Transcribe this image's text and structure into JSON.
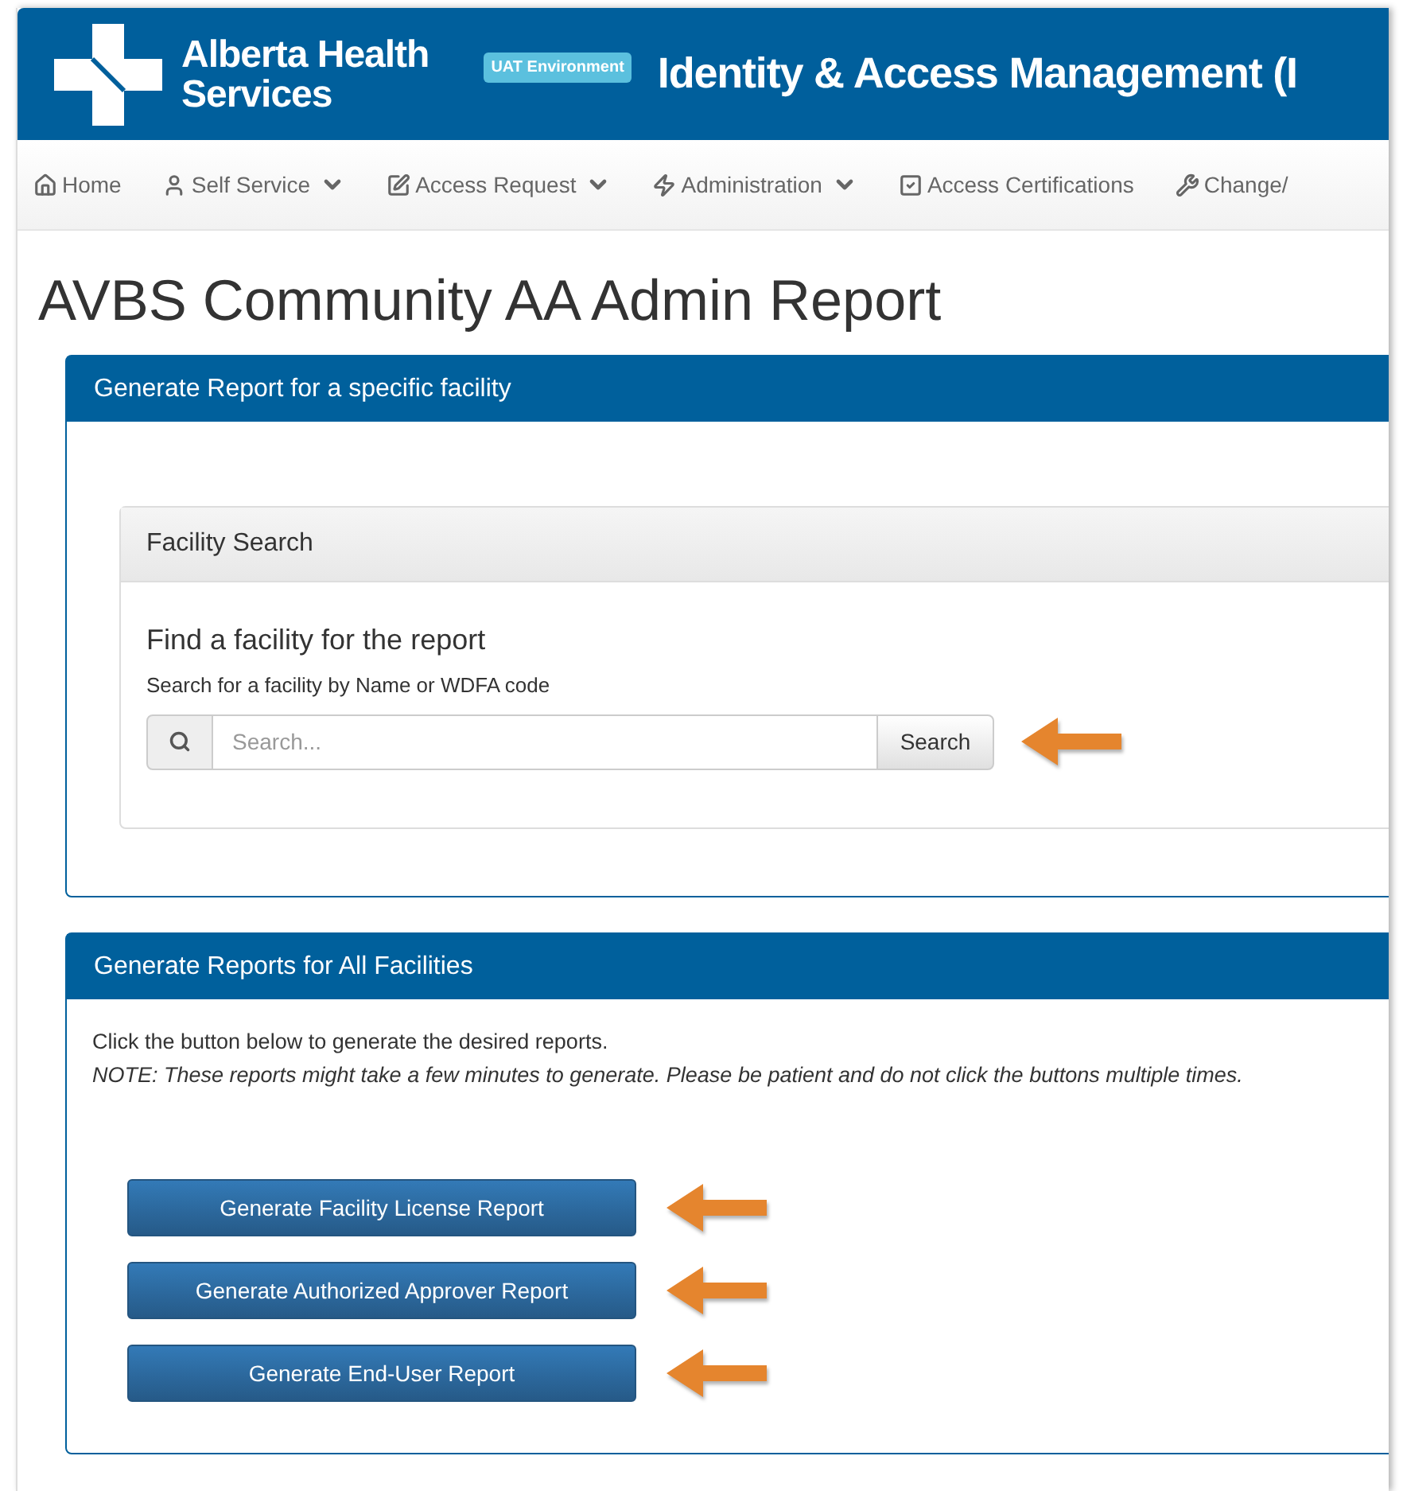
{
  "header": {
    "logo_lines": [
      "Alberta Health",
      "Services"
    ],
    "badge": "UAT Environment",
    "title": "Identity & Access Management (I"
  },
  "nav": [
    {
      "label": "Home",
      "dropdown": false
    },
    {
      "label": "Self Service",
      "dropdown": true
    },
    {
      "label": "Access Request",
      "dropdown": true
    },
    {
      "label": "Administration",
      "dropdown": true
    },
    {
      "label": "Access Certifications",
      "dropdown": false
    },
    {
      "label": "Change/",
      "dropdown": false
    }
  ],
  "page_title": "AVBS Community AA Admin Report",
  "specific_panel": {
    "title": "Generate Report for a specific facility",
    "search_panel": {
      "title": "Facility Search",
      "heading": "Find a facility for the report",
      "hint": "Search for a facility by Name or WDFA code",
      "placeholder": "Search...",
      "button": "Search"
    }
  },
  "all_panel": {
    "title": "Generate Reports for All Facilities",
    "intro": "Click the button below to generate the desired reports.",
    "note": "NOTE: These reports might take a few minutes to generate. Please be patient and do not click the buttons multiple times.",
    "buttons": [
      "Generate Facility License Report",
      "Generate Authorized Approver Report",
      "Generate End-User Report"
    ]
  }
}
